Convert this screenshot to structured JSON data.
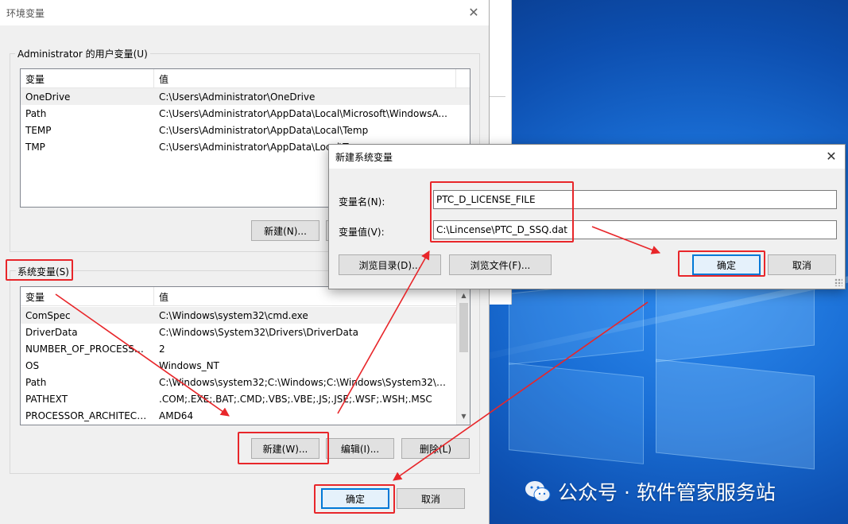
{
  "env_window": {
    "title": "环境变量",
    "user_vars_label": "Administrator 的用户变量(U)",
    "columns": [
      "变量",
      "值"
    ],
    "user_vars": [
      {
        "name": "OneDrive",
        "value": "C:\\Users\\Administrator\\OneDrive"
      },
      {
        "name": "Path",
        "value": "C:\\Users\\Administrator\\AppData\\Local\\Microsoft\\WindowsA..."
      },
      {
        "name": "TEMP",
        "value": "C:\\Users\\Administrator\\AppData\\Local\\Temp"
      },
      {
        "name": "TMP",
        "value": "C:\\Users\\Administrator\\AppData\\Local\\Temp"
      }
    ],
    "user_new_label": "新建(N)...",
    "system_vars_label": "系统变量(S)",
    "system_vars": [
      {
        "name": "ComSpec",
        "value": "C:\\Windows\\system32\\cmd.exe"
      },
      {
        "name": "DriverData",
        "value": "C:\\Windows\\System32\\Drivers\\DriverData"
      },
      {
        "name": "NUMBER_OF_PROCESSORS",
        "value": "2"
      },
      {
        "name": "OS",
        "value": "Windows_NT"
      },
      {
        "name": "Path",
        "value": "C:\\Windows\\system32;C:\\Windows;C:\\Windows\\System32\\Wb..."
      },
      {
        "name": "PATHEXT",
        "value": ".COM;.EXE;.BAT;.CMD;.VBS;.VBE;.JS;.JSE;.WSF;.WSH;.MSC"
      },
      {
        "name": "PROCESSOR_ARCHITECT...",
        "value": "AMD64"
      }
    ],
    "sys_new_label": "新建(W)...",
    "sys_edit_label": "编辑(I)...",
    "sys_delete_label": "删除(L)",
    "ok_label": "确定",
    "cancel_label": "取消"
  },
  "new_var_dialog": {
    "title": "新建系统变量",
    "name_label": "变量名(N):",
    "name_value": "PTC_D_LICENSE_FILE",
    "value_label": "变量值(V):",
    "value_value": "C:\\Lincense\\PTC_D_SSQ.dat",
    "browse_dir_label": "浏览目录(D)...",
    "browse_file_label": "浏览文件(F)...",
    "ok_label": "确定",
    "cancel_label": "取消"
  },
  "watermark": {
    "text": "公众号 · 软件管家服务站"
  },
  "colors": {
    "annotation_red": "#e8262a",
    "focus_blue": "#0078d7",
    "dialog_bg": "#f0f0f0"
  }
}
